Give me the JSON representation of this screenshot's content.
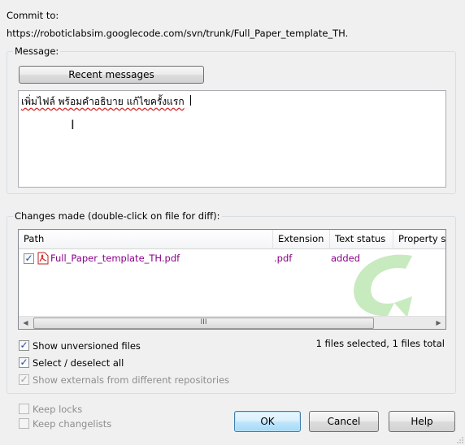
{
  "commit": {
    "label": "Commit to:",
    "url": "https://roboticlabsim.googlecode.com/svn/trunk/Full_Paper_template_TH."
  },
  "message": {
    "group_label": "Message:",
    "recent_button": "Recent messages",
    "text": "เพิ่มไฟล์ พร้อมคำอธิบาย แก้ไขครั้งแรก"
  },
  "changes": {
    "group_label": "Changes made (double-click on file for diff):",
    "columns": [
      "Path",
      "Extension",
      "Text status",
      "Property s"
    ],
    "rows": [
      {
        "checked": true,
        "path": "Full_Paper_template_TH.pdf",
        "extension": ".pdf",
        "text_status": "added",
        "icon": "pdf-file-icon"
      }
    ],
    "scroll_grip": "III",
    "selection_summary": "1 files selected, 1 files total",
    "accent_color": "#8b008b"
  },
  "options": {
    "show_unversioned": {
      "label": "Show unversioned files",
      "checked": true
    },
    "select_all": {
      "label": "Select / deselect all",
      "checked": true
    },
    "show_externals": {
      "label": "Show externals from different repositories",
      "checked": true,
      "enabled": false
    },
    "keep_locks": {
      "label": "Keep locks",
      "checked": false,
      "enabled": false
    },
    "keep_changelists": {
      "label": "Keep changelists",
      "checked": false,
      "enabled": false
    }
  },
  "buttons": {
    "ok": "OK",
    "cancel": "Cancel",
    "help": "Help"
  }
}
